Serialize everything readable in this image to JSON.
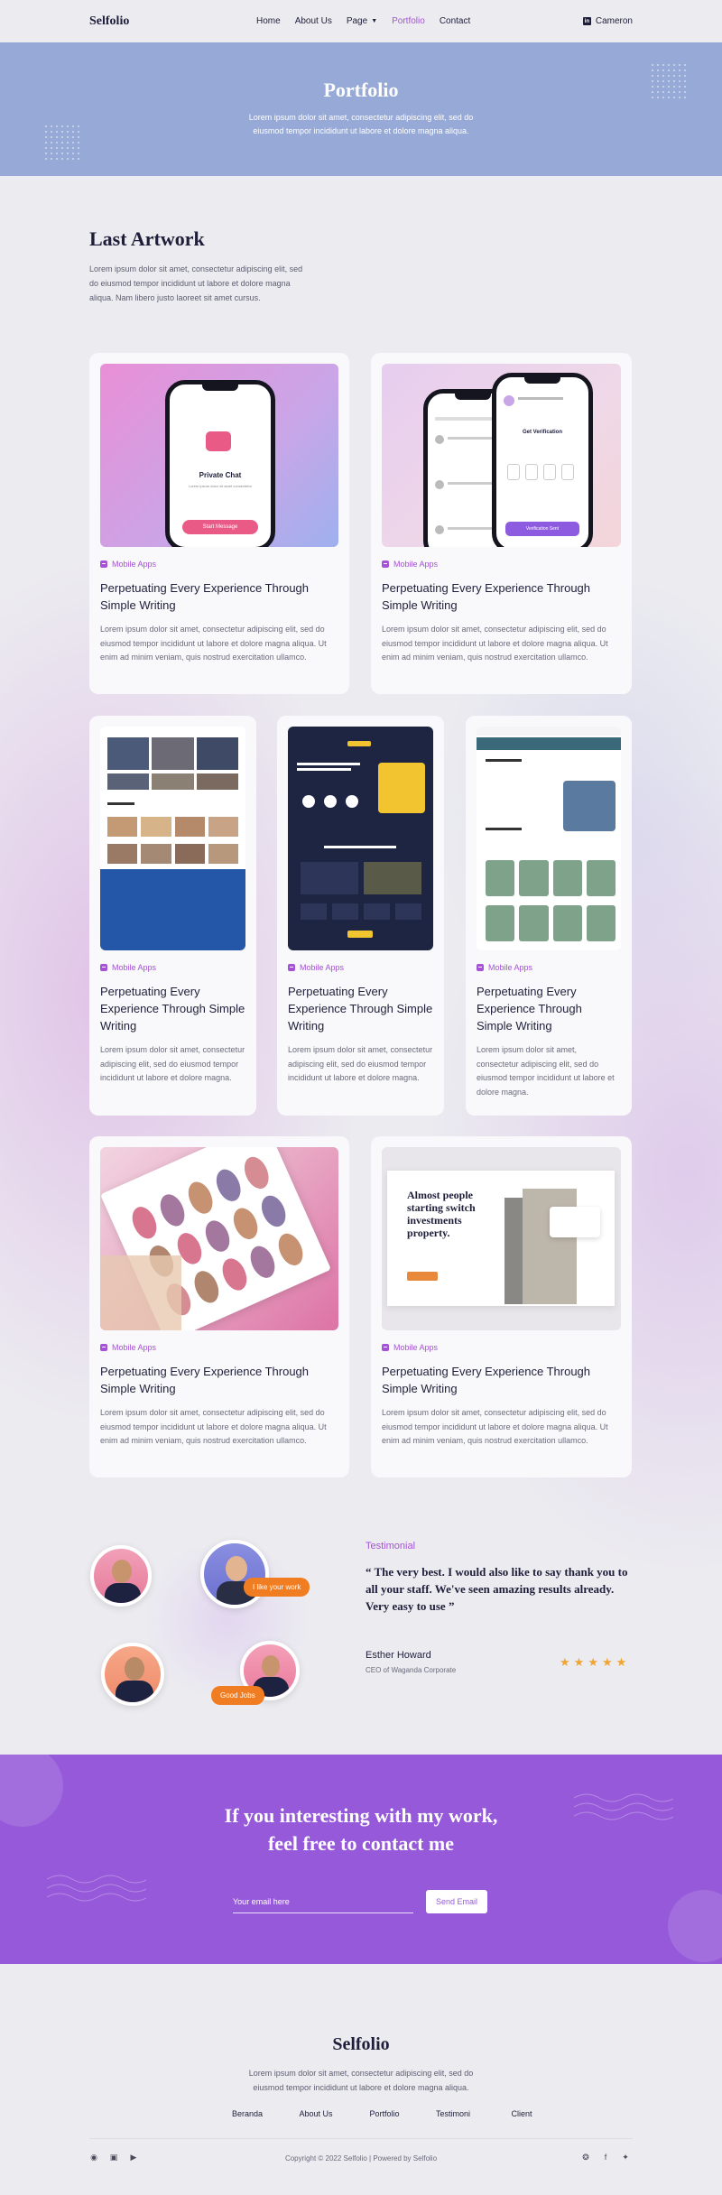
{
  "nav": {
    "logo": "Selfolio",
    "links": [
      "Home",
      "About Us",
      "Page",
      "Portfolio",
      "Contact"
    ],
    "user": "Cameron"
  },
  "hero": {
    "title": "Portfolio",
    "text": "Lorem ipsum dolor sit amet, consectetur adipiscing elit, sed do eiusmod tempor incididunt ut labore et dolore magna aliqua."
  },
  "section": {
    "title": "Last Artwork",
    "desc": "Lorem ipsum dolor sit amet, consectetur adipiscing elit, sed do eiusmod tempor incididunt ut labore et dolore magna aliqua. Nam libero justo laoreet sit amet cursus."
  },
  "cards": [
    {
      "tag": "Mobile Apps",
      "title": "Perpetuating Every Experience Through Simple Writing",
      "text": "Lorem ipsum dolor sit amet, consectetur adipiscing elit, sed do eiusmod tempor incididunt ut labore et dolore magna aliqua. Ut enim ad minim veniam, quis nostrud exercitation ullamco.",
      "thumb_text": [
        "Private Chat",
        "Start Message"
      ]
    },
    {
      "tag": "Mobile Apps",
      "title": "Perpetuating Every Experience Through Simple Writing",
      "text": "Lorem ipsum dolor sit amet, consectetur adipiscing elit, sed do eiusmod tempor incididunt ut labore et dolore magna aliqua. Ut enim ad minim veniam, quis nostrud exercitation ullamco.",
      "thumb_text": [
        "Get Verification",
        "Verification Sent"
      ]
    },
    {
      "tag": "Mobile Apps",
      "title": "Perpetuating Every Experience Through Simple Writing",
      "text": "Lorem ipsum dolor sit amet, consectetur adipiscing elit, sed do eiusmod tempor incididunt ut labore et dolore magna."
    },
    {
      "tag": "Mobile Apps",
      "title": "Perpetuating Every Experience Through Simple Writing",
      "text": "Lorem ipsum dolor sit amet, consectetur adipiscing elit, sed do eiusmod tempor incididunt ut labore et dolore magna."
    },
    {
      "tag": "Mobile Apps",
      "title": "Perpetuating Every Experience Through Simple Writing",
      "text": "Lorem ipsum dolor sit amet, consectetur adipiscing elit, sed do eiusmod tempor incididunt ut labore et dolore magna."
    },
    {
      "tag": "Mobile Apps",
      "title": "Perpetuating Every Experience Through Simple Writing",
      "text": "Lorem ipsum dolor sit amet, consectetur adipiscing elit, sed do eiusmod tempor incididunt ut labore et dolore magna aliqua. Ut enim ad minim veniam, quis nostrud exercitation ullamco."
    },
    {
      "tag": "Mobile Apps",
      "title": "Perpetuating Every Experience Through Simple Writing",
      "text": "Lorem ipsum dolor sit amet, consectetur adipiscing elit, sed do eiusmod tempor incididunt ut labore et dolore magna aliqua. Ut enim ad minim veniam, quis nostrud exercitation ullamco.",
      "thumb_text": [
        "Almost people starting switch investments property."
      ]
    }
  ],
  "testimonial": {
    "label": "Testimonial",
    "quote": "“ The very best. I would also like to say thank you to all your staff. We've seen amazing results already. Very easy to use ”",
    "name": "Esther Howard",
    "role": "CEO of Waganda Corporate",
    "rating": 5,
    "bubbles": [
      "I like your work",
      "Good Jobs"
    ]
  },
  "cta": {
    "title_line1": "If you interesting with my work,",
    "title_line2": "feel free to contact me",
    "placeholder": "Your email here",
    "button": "Send Email"
  },
  "footer": {
    "logo": "Selfolio",
    "desc": "Lorem ipsum dolor sit amet, consectetur adipiscing elit, sed do eiusmod tempor incididunt ut labore et dolore magna aliqua.",
    "links": [
      "Beranda",
      "About Us",
      "Portfolio",
      "Testimoni",
      "Client"
    ],
    "copyright": "Copyright © 2022 Selfolio | Powered by Selfolio"
  },
  "colors": {
    "accent": "#a552d6",
    "hero_bg": "#97a9d6",
    "cta_bg": "#9659d9",
    "orange": "#f07d22",
    "star": "#f0a431"
  },
  "icons": [
    "chevron-down-icon",
    "linkedin-icon",
    "tag-icon",
    "star-icon",
    "messenger-icon",
    "instagram-icon",
    "youtube-icon",
    "dribbble-icon",
    "facebook-icon",
    "twitter-icon"
  ]
}
